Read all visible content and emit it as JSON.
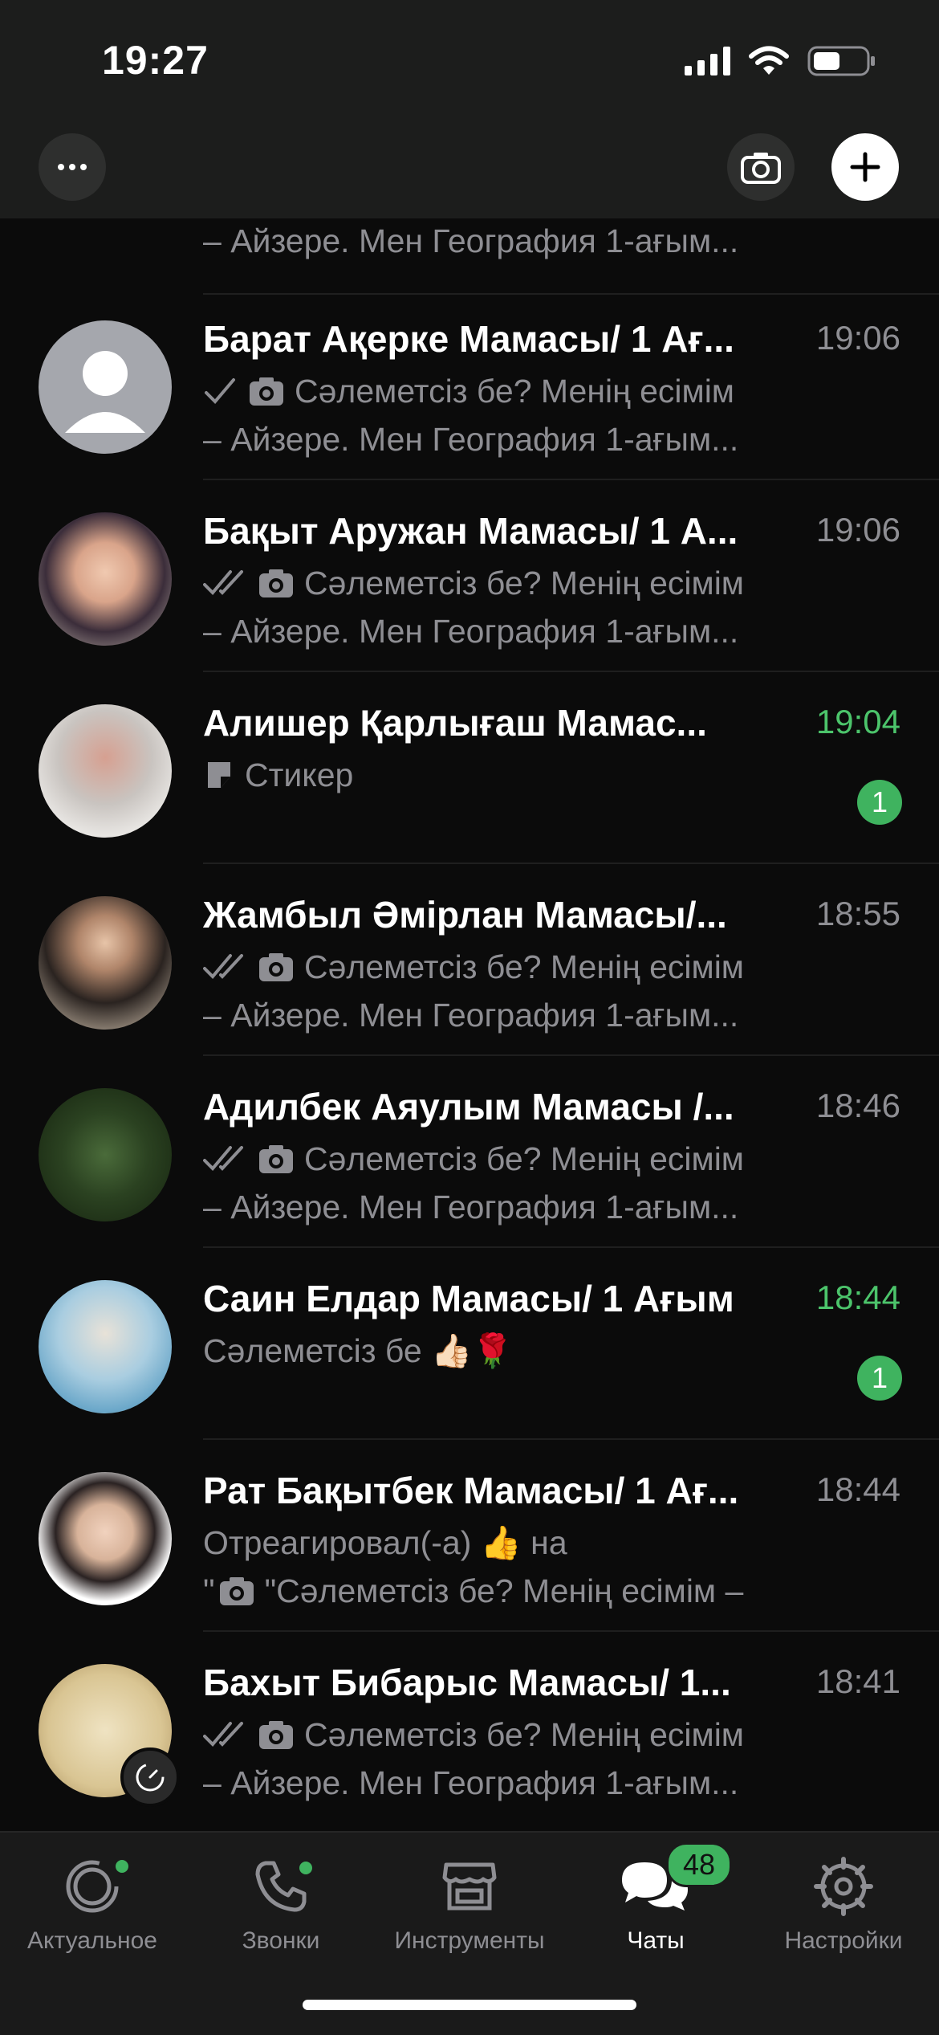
{
  "status_bar": {
    "time": "19:27"
  },
  "top_bar": {
    "more": "more",
    "camera": "camera",
    "new_chat": "new-chat"
  },
  "chats": [
    {
      "name": "",
      "time": "",
      "preview": [
        "",
        "– Айзере. Мен География 1-ағым..."
      ],
      "status": "none",
      "icon": "none"
    },
    {
      "name": "Барат Ақерке Мамасы/ 1 Ағ...",
      "time": "19:06",
      "preview": [
        "Сәлеметсіз бе? Менің есімім",
        "– Айзере. Мен География 1-ағым..."
      ],
      "status": "sent",
      "icon": "camera"
    },
    {
      "name": "Бақыт Аружан Мамасы/ 1 А...",
      "time": "19:06",
      "preview": [
        "Сәлеметсіз бе? Менің есімім",
        "– Айзере. Мен География 1-ағым..."
      ],
      "status": "delivered",
      "icon": "camera"
    },
    {
      "name": "Алишер Қарлығаш Мамас...",
      "time": "19:04",
      "unread": "1",
      "preview": [
        "Стикер"
      ],
      "status": "none",
      "icon": "sticker"
    },
    {
      "name": "Жамбыл Әмірлан Мамасы/...",
      "time": "18:55",
      "preview": [
        "Сәлеметсіз бе? Менің есімім",
        "– Айзере. Мен География 1-ағым..."
      ],
      "status": "delivered",
      "icon": "camera"
    },
    {
      "name": "Адилбек Аяулым Мамасы /...",
      "time": "18:46",
      "preview": [
        "Сәлеметсіз бе? Менің есімім",
        "– Айзере. Мен География 1-ағым..."
      ],
      "status": "delivered",
      "icon": "camera"
    },
    {
      "name": "Саин Елдар Мамасы/ 1 Ағым",
      "time": "18:44",
      "unread": "1",
      "preview": [
        "Сәлеметсіз бе 👍🏻🌹"
      ],
      "status": "none",
      "icon": "none"
    },
    {
      "name": "Рат Бақытбек Мамасы/ 1 Ағ...",
      "time": "18:44",
      "preview": [
        "Отреагировал(-а) 👍 на",
        "\"Сәлеметсіз бе? Менің есімім –"
      ],
      "status": "none",
      "icon": "camera-line2"
    },
    {
      "name": "Бахыт Бибарыс Мамасы/ 1...",
      "time": "18:41",
      "preview": [
        "Сәлеметсіз бе? Менің есімім",
        "– Айзере. Мен География 1-ағым..."
      ],
      "status": "delivered",
      "icon": "camera"
    }
  ],
  "tabs": [
    {
      "label": "Актуальное",
      "icon": "updates-icon"
    },
    {
      "label": "Звонки",
      "icon": "phone-icon"
    },
    {
      "label": "Инструменты",
      "icon": "store-icon"
    },
    {
      "label": "Чаты",
      "icon": "chats-icon",
      "badge": "48",
      "active": true
    },
    {
      "label": "Настройки",
      "icon": "gear-icon"
    }
  ],
  "colors": {
    "accent": "#3fb35f",
    "background": "#0b0b0b",
    "secondary_text": "#8e8e93"
  }
}
